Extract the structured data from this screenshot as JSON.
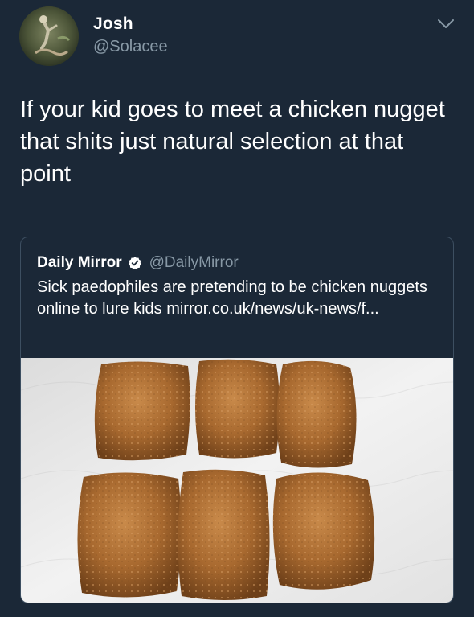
{
  "tweet": {
    "author_name": "Josh",
    "author_handle": "@Solacee",
    "text": "If your kid goes to meet a chicken nugget that shits just natural selection at that point",
    "menu_icon": "chevron-down-icon"
  },
  "quoted_tweet": {
    "author_name": "Daily Mirror",
    "verified_icon": "verified-badge-icon",
    "author_handle": "@DailyMirror",
    "text": "Sick paedophiles are pretending to be chicken nuggets online to lure kids mirror.co.uk/news/uk-news/f...",
    "image": "chicken-nuggets-photo"
  },
  "colors": {
    "background": "#1b2837",
    "secondary_text": "#8899a6",
    "card_border": "#3d4f61",
    "verified_blue": "#ffffff"
  }
}
